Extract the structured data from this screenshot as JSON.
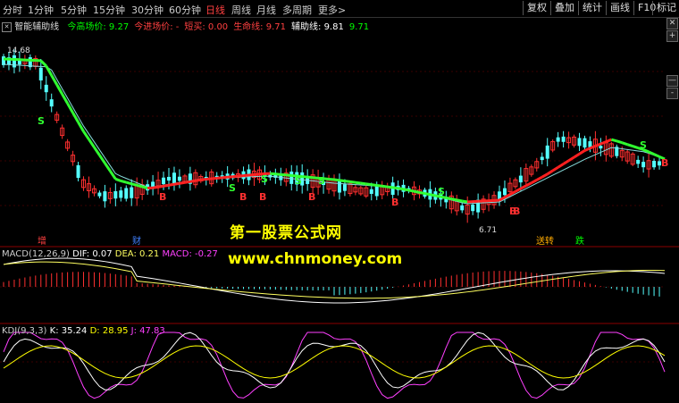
{
  "toolbar": {
    "period_tabs": [
      "分时",
      "1分钟",
      "5分钟",
      "15分钟",
      "30分钟",
      "60分钟",
      "日线",
      "周线",
      "月线",
      "多周期",
      "更多>"
    ],
    "active_tab": "日线",
    "right_buttons": [
      "复权",
      "叠加",
      "统计",
      "画线",
      "F10",
      "标记"
    ]
  },
  "main_panel": {
    "indicator_name": "智能辅助线",
    "params": [
      {
        "label": "今高场价: 9.27",
        "color": "#00ff00"
      },
      {
        "label": "今进场价: -",
        "color": "#ff4040"
      },
      {
        "label": "短买: 0.00",
        "color": "#ff4040"
      },
      {
        "label": "生命线: 9.71",
        "color": "#ff4040"
      },
      {
        "label": "辅助线: 9.81",
        "color": "#ffffff"
      },
      {
        "label": "9.71",
        "color": "#00ff00"
      }
    ],
    "high_label": "14.68",
    "low_label": "6.71",
    "buy_marks": [
      "B",
      "B",
      "B",
      "B",
      "B",
      "B",
      "B",
      "B"
    ],
    "sell_marks": [
      "S",
      "S",
      "S",
      "S",
      "S",
      "S",
      "S"
    ]
  },
  "event_markers": [
    {
      "label": "增",
      "color": "#ff4040"
    },
    {
      "label": "财",
      "color": "#4080ff"
    },
    {
      "label": "送转",
      "color": "#ffaa00"
    },
    {
      "label": "跌",
      "color": "#00ff00"
    }
  ],
  "macd_panel": {
    "title": "MACD(12,26,9)",
    "dif": "DIF: 0.07",
    "dea": "DEA: 0.21",
    "macd": "MACD: -0.27"
  },
  "kdj_panel": {
    "title": "KDJ(9,3,3)",
    "k": "K: 35.24",
    "d": "D: 28.95",
    "j": "J: 47.83"
  },
  "watermark": {
    "line1": "第一股票公式网",
    "line2": "www.chnmoney.com"
  },
  "colors": {
    "up": "#ff3030",
    "down": "#54ffff",
    "life_line_up": "#ff2020",
    "life_line_down": "#30ff30",
    "helper_line": "#88dddd",
    "dif": "#ffffff",
    "dea": "#ffff60",
    "k": "#ffffff",
    "d": "#ffff00",
    "j": "#ff40ff"
  }
}
